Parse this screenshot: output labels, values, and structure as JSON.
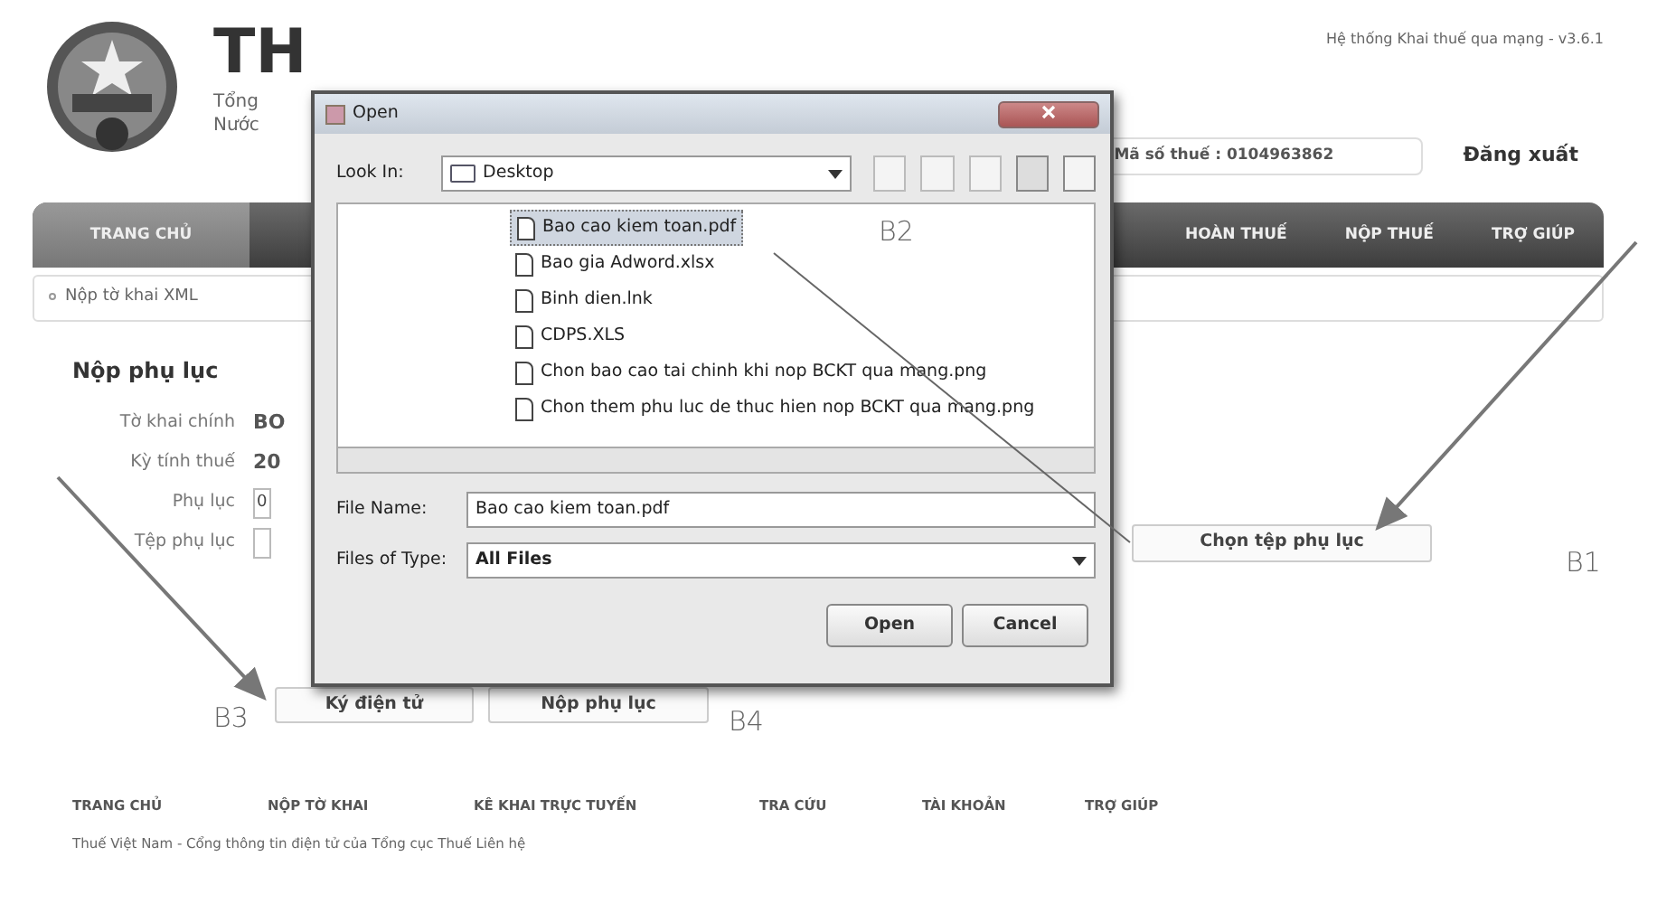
{
  "header": {
    "title": "TH",
    "subtitle_lines": [
      "Tổng",
      "Nước"
    ],
    "system": "Hệ thống Khai thuế qua mạng - v3.6.1",
    "tax_id": "Mã số thuế : 0104963862",
    "logout": "Đăng xuất"
  },
  "nav": [
    {
      "label": "TRANG CHỦ",
      "selected": true
    },
    {
      "label": "HOÀN THUẾ",
      "selected": false
    },
    {
      "label": "NỘP THUẾ",
      "selected": false
    },
    {
      "label": "TRỢ GIÚP",
      "selected": false
    }
  ],
  "breadcrumb": "Nộp tờ khai XML",
  "form": {
    "title": "Nộp phụ lục",
    "fields": [
      {
        "label": "Tờ khai chính",
        "value": "BO",
        "kind": "text"
      },
      {
        "label": "Kỳ tính thuế",
        "value": "20",
        "kind": "text"
      },
      {
        "label": "Phụ lục",
        "value": "0",
        "kind": "input"
      },
      {
        "label": "Tệp phụ lục",
        "kind": "input"
      }
    ],
    "choose_button": "Chọn tệp phụ lục",
    "buttons": [
      "Ký điện tử",
      "Nộp phụ lục"
    ]
  },
  "footer": {
    "links": [
      "TRANG CHỦ",
      "NỘP TỜ KHAI",
      "KÊ KHAI TRỰC TUYẾN",
      "TRA CỨU",
      "TÀI KHOẢN",
      "TRỢ GIÚP"
    ],
    "text": "Thuế Việt Nam - Cổng thông tin điện tử của Tổng cục Thuế Liên hệ"
  },
  "dialog": {
    "title": "Open",
    "look_in_label": "Look In:",
    "look_in": "Desktop",
    "files": [
      {
        "name": "Bao cao kiem toan.pdf",
        "selected": true
      },
      {
        "name": "Bao gia Adword.xlsx",
        "selected": false
      },
      {
        "name": "Binh dien.lnk",
        "selected": false
      },
      {
        "name": "CDPS.XLS",
        "selected": false
      },
      {
        "name": "Chon bao cao tai chinh khi nop BCKT qua mang.png",
        "selected": false
      },
      {
        "name": "Chon them phu luc de thuc hien nop BCKT qua mang.png",
        "selected": false
      }
    ],
    "file_name_label": "File Name:",
    "file_name": "Bao cao kiem toan.pdf",
    "type_label": "Files of Type:",
    "type": "All Files",
    "buttons": [
      "Open",
      "Cancel"
    ]
  },
  "annotations": [
    "B1",
    "B2",
    "B3",
    "B4"
  ]
}
